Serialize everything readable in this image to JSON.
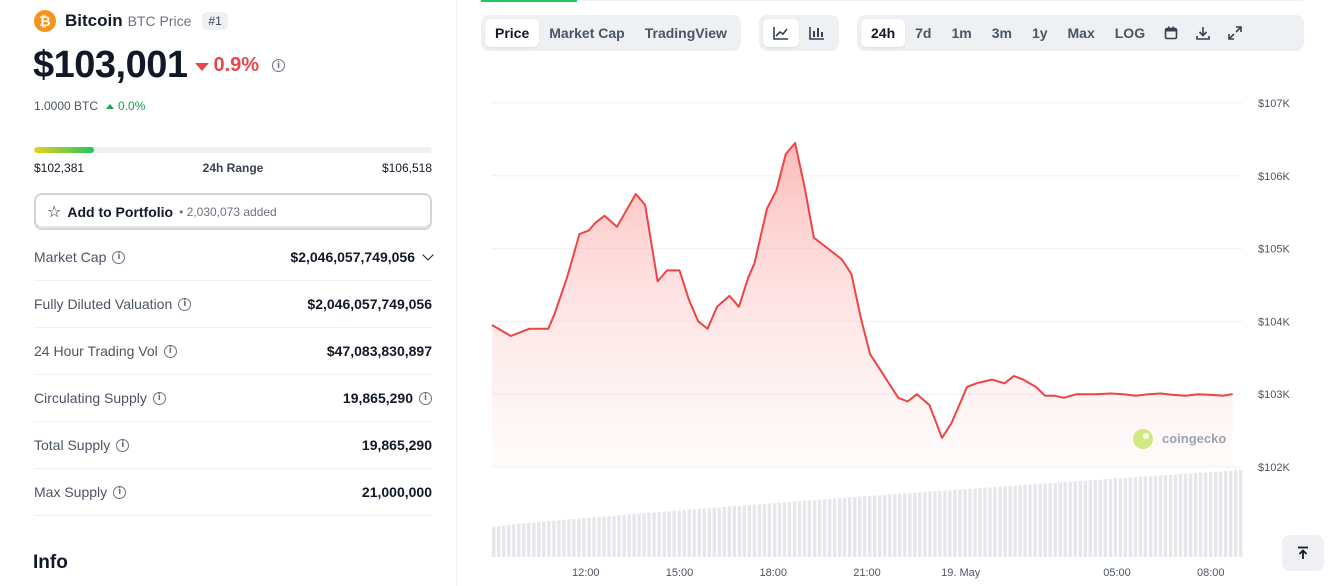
{
  "coin": {
    "name": "Bitcoin",
    "symbol_label": "BTC Price",
    "rank": "#1",
    "logo_glyph": "₿",
    "price": "$103,001",
    "change_24h": "0.9%",
    "change_direction": "down",
    "btc_value": "1.0000 BTC",
    "btc_change": "0.0%"
  },
  "range": {
    "low": "$102,381",
    "label": "24h Range",
    "high": "$106,518",
    "position_fraction": 0.15
  },
  "portfolio": {
    "label": "Add to Portfolio",
    "count": "• 2,030,073 added"
  },
  "stats": [
    {
      "label": "Market Cap",
      "value": "$2,046,057,749,056",
      "has_chevron": true,
      "value_info": false
    },
    {
      "label": "Fully Diluted Valuation",
      "value": "$2,046,057,749,056",
      "has_chevron": false,
      "value_info": false
    },
    {
      "label": "24 Hour Trading Vol",
      "value": "$47,083,830,897",
      "has_chevron": false,
      "value_info": false
    },
    {
      "label": "Circulating Supply",
      "value": "19,865,290",
      "has_chevron": false,
      "value_info": true
    },
    {
      "label": "Total Supply",
      "value": "19,865,290",
      "has_chevron": false,
      "value_info": false
    },
    {
      "label": "Max Supply",
      "value": "21,000,000",
      "has_chevron": false,
      "value_info": false
    }
  ],
  "info_heading": "Info",
  "chart_tabs": {
    "view": [
      "Price",
      "Market Cap",
      "TradingView"
    ],
    "active_view": "Price",
    "chart_type_icons": [
      "line-chart-icon",
      "candlestick-icon"
    ],
    "ranges": [
      "24h",
      "7d",
      "1m",
      "3m",
      "1y",
      "Max",
      "LOG"
    ],
    "active_range": "24h",
    "tool_icons": [
      "calendar-icon",
      "download-icon",
      "expand-icon"
    ]
  },
  "watermark": "coingecko",
  "colors": {
    "down": "#e5484d",
    "up": "#16a34a",
    "btc_orange": "#f7931a",
    "line": "#ef4444",
    "fill": "#fca5a5"
  },
  "chart_data": {
    "type": "area",
    "title": "",
    "xlabel": "",
    "ylabel": "",
    "ylim": [
      102000,
      107000
    ],
    "yticks": [
      "$107K",
      "$106K",
      "$105K",
      "$104K",
      "$103K",
      "$102K"
    ],
    "ytick_values": [
      107000,
      106000,
      105000,
      104000,
      103000,
      102000
    ],
    "xticks": [
      "12:00",
      "15:00",
      "18:00",
      "21:00",
      "19. May",
      "05:00",
      "08:00"
    ],
    "xtick_hours": [
      3.0,
      6.0,
      9.0,
      12.0,
      15.0,
      20.0,
      23.0
    ],
    "x_hours": [
      0,
      0.6,
      1.2,
      1.8,
      2.0,
      2.4,
      2.8,
      3.1,
      3.3,
      3.6,
      4.0,
      4.6,
      4.9,
      5.3,
      5.6,
      6.0,
      6.3,
      6.6,
      6.9,
      7.2,
      7.6,
      7.9,
      8.2,
      8.4,
      8.8,
      9.1,
      9.4,
      9.7,
      10.0,
      10.3,
      10.6,
      10.9,
      11.2,
      11.5,
      11.8,
      12.1,
      12.4,
      12.7,
      13.0,
      13.3,
      13.6,
      14.0,
      14.4,
      14.7,
      15.0,
      15.2,
      15.5,
      16.0,
      16.4,
      16.7,
      17.0,
      17.4,
      17.7,
      18.0,
      18.3,
      18.7,
      19.0,
      19.3,
      19.8,
      20.2,
      20.6,
      21.0,
      21.4,
      21.8,
      22.2,
      22.6,
      23.0,
      23.4,
      23.7
    ],
    "values": [
      103950,
      103800,
      103900,
      103900,
      104100,
      104600,
      105200,
      105250,
      105350,
      105450,
      105300,
      105750,
      105600,
      104550,
      104700,
      104700,
      104300,
      104000,
      103900,
      104200,
      104350,
      104200,
      104600,
      104800,
      105550,
      105800,
      106300,
      106450,
      105850,
      105150,
      105050,
      104950,
      104850,
      104650,
      104050,
      103550,
      103350,
      103150,
      102950,
      102900,
      103000,
      102850,
      102400,
      102600,
      102900,
      103100,
      103150,
      103200,
      103150,
      103250,
      103200,
      103100,
      102980,
      102980,
      102950,
      103000,
      103000,
      103000,
      103010,
      103000,
      102980,
      103000,
      103010,
      102990,
      102980,
      103000,
      102990,
      102980,
      103001
    ],
    "volume_relative_start": 0.35,
    "volume_relative_end": 1.0
  }
}
